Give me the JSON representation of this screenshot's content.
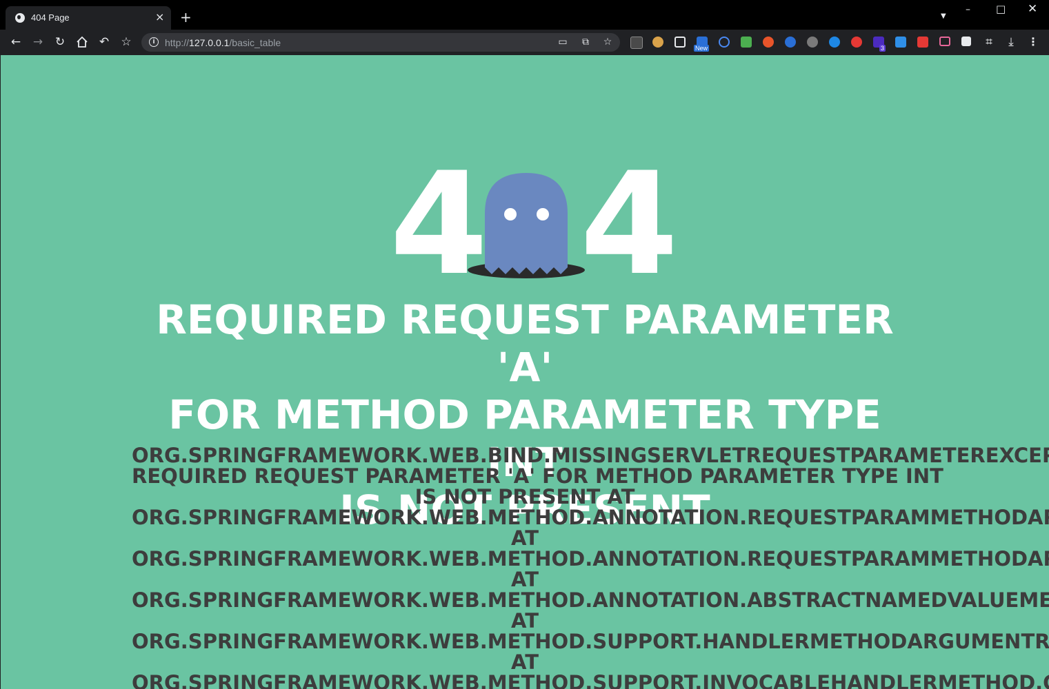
{
  "browser": {
    "tab_title": "404 Page",
    "tab_close": "×",
    "new_tab": "+",
    "url_scheme": "http://",
    "url_host": "127.0.0.1",
    "url_path": "/basic_table",
    "ext_badge_new": "New",
    "ext_badge_count": "3"
  },
  "error_page": {
    "digit_left": "4",
    "digit_right": "4",
    "heading_line1": "Required request parameter 'a'",
    "heading_line2": "for method parameter type int",
    "heading_line3": "is not present",
    "trace": [
      "org.springframework.web.bind.MissingServletRequestParameterException:",
      "Required request parameter 'a' for method parameter type int",
      "is not present at",
      "org.springframework.web.method.annotation.RequestParamMethodArgumentResolver",
      "at",
      "org.springframework.web.method.annotation.RequestParamMethodArgumentResolver",
      "at",
      "org.springframework.web.method.annotation.AbstractNamedValueMethodArgumentResolver",
      "at",
      "org.springframework.web.method.support.HandlerMethodArgumentResolverComposite",
      "at",
      "org.springframework.web.method.support.InvocableHandlerMethod.getMethodArgumentValues"
    ]
  },
  "colors": {
    "page_background": "#6ac4a2",
    "ghost": "#6a88c0",
    "heading_text": "#ffffff",
    "trace_text": "#3d3d3d",
    "chrome_dark": "#202124"
  },
  "icons": {
    "back": "arrow-left-icon",
    "forward": "arrow-right-icon",
    "reload": "reload-icon",
    "home": "home-icon",
    "undo": "undo-icon",
    "bookmark": "star-icon",
    "site_info": "info-icon",
    "menu": "three-dots-icon"
  }
}
